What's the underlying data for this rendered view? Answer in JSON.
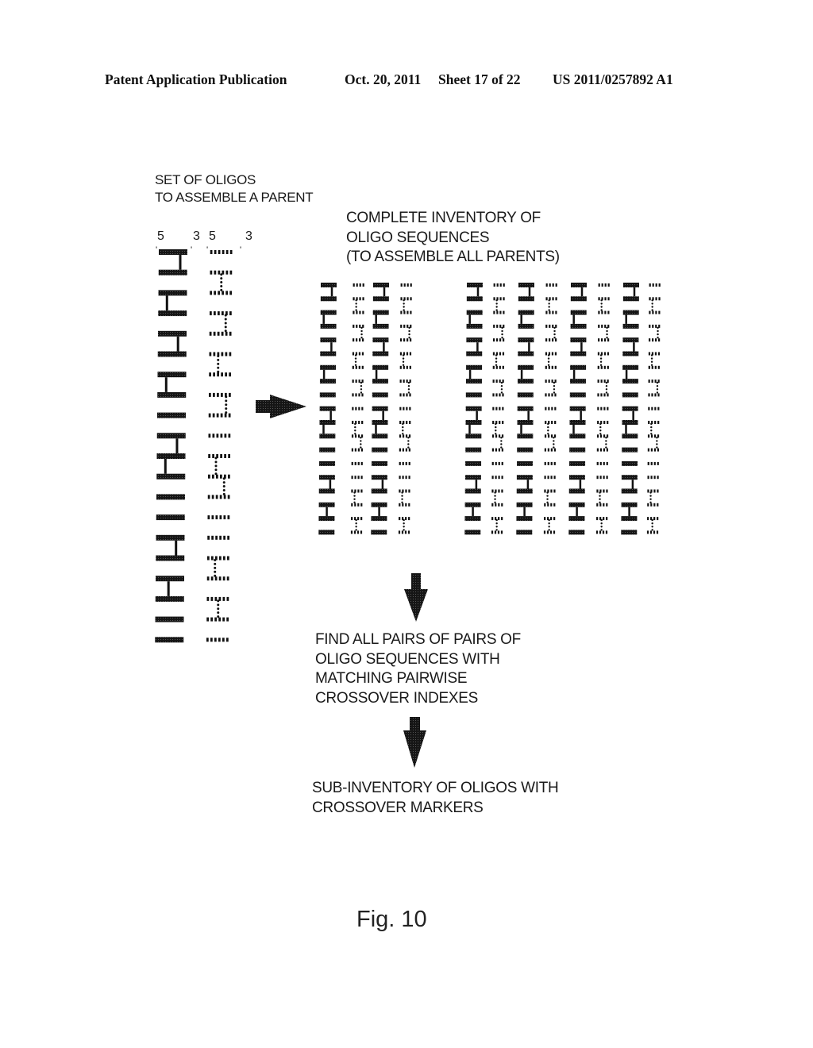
{
  "header": {
    "publication": "Patent Application Publication",
    "date": "Oct. 20, 2011",
    "sheet": "Sheet 17 of 22",
    "patent_number": "US 2011/0257892 A1"
  },
  "parent_set": {
    "title_lines": [
      "SET OF OLIGOS",
      "TO ASSEMBLE A PARENT"
    ],
    "strand_labels": {
      "solid": {
        "five_prime": "5",
        "three_prime": "3"
      },
      "dotted": {
        "five_prime": "5",
        "three_prime": "3"
      }
    },
    "oligo_count": 20,
    "solid_links": [
      {
        "from": 0,
        "to": 1,
        "pos": 0.75
      },
      {
        "from": 2,
        "to": 3,
        "pos": 0.3
      },
      {
        "from": 4,
        "to": 5,
        "pos": 0.7
      },
      {
        "from": 6,
        "to": 7,
        "pos": 0.3
      },
      {
        "from": 9,
        "to": 10,
        "pos": 0.7
      },
      {
        "from": 10,
        "to": 11,
        "pos": 0.3
      },
      {
        "from": 14,
        "to": 15,
        "pos": 0.7
      },
      {
        "from": 16,
        "to": 17,
        "pos": 0.45
      }
    ],
    "dotted_links": [
      {
        "from": 1,
        "to": 2,
        "pos": 0.5
      },
      {
        "from": 3,
        "to": 4,
        "pos": 0.7
      },
      {
        "from": 5,
        "to": 6,
        "pos": 0.4
      },
      {
        "from": 7,
        "to": 8,
        "pos": 0.75
      },
      {
        "from": 10,
        "to": 11,
        "pos": 0.35
      },
      {
        "from": 11,
        "to": 12,
        "pos": 0.7
      },
      {
        "from": 15,
        "to": 16,
        "pos": 0.35
      },
      {
        "from": 17,
        "to": 18,
        "pos": 0.5
      }
    ]
  },
  "inventory": {
    "title_lines": [
      "COMPLETE INVENTORY OF",
      "OLIGO SEQUENCES",
      "(TO ASSEMBLE ALL PARENTS)"
    ],
    "groups": [
      {
        "name": "group-1",
        "parents": 2
      },
      {
        "name": "group-2",
        "parents": 4
      }
    ],
    "oligo_rows": 20,
    "solid_links": [
      {
        "from": 0,
        "to": 1,
        "pos": 0.7
      },
      {
        "from": 2,
        "to": 3,
        "pos": 0.2
      },
      {
        "from": 4,
        "to": 5,
        "pos": 0.7
      },
      {
        "from": 6,
        "to": 7,
        "pos": 0.25
      },
      {
        "from": 9,
        "to": 10,
        "pos": 0.7
      },
      {
        "from": 10,
        "to": 11,
        "pos": 0.25
      },
      {
        "from": 14,
        "to": 15,
        "pos": 0.7
      },
      {
        "from": 16,
        "to": 17,
        "pos": 0.5
      }
    ],
    "dotted_links": [
      {
        "from": 1,
        "to": 2,
        "pos": 0.3
      },
      {
        "from": 3,
        "to": 4,
        "pos": 0.75
      },
      {
        "from": 5,
        "to": 6,
        "pos": 0.3
      },
      {
        "from": 7,
        "to": 8,
        "pos": 0.75
      },
      {
        "from": 10,
        "to": 11,
        "pos": 0.3
      },
      {
        "from": 11,
        "to": 12,
        "pos": 0.75
      },
      {
        "from": 15,
        "to": 16,
        "pos": 0.3
      },
      {
        "from": 17,
        "to": 18,
        "pos": 0.45
      }
    ]
  },
  "steps": [
    {
      "lines": [
        "FIND ALL PAIRS OF PAIRS OF",
        "OLIGO SEQUENCES WITH",
        "MATCHING PAIRWISE",
        "CROSSOVER INDEXES"
      ]
    },
    {
      "lines": [
        "SUB-INVENTORY OF OLIGOS WITH",
        "CROSSOVER MARKERS"
      ]
    }
  ],
  "arrows": [
    {
      "name": "parent-to-inventory-arrow",
      "direction": "right"
    },
    {
      "name": "inventory-to-pairs-arrow",
      "direction": "down"
    },
    {
      "name": "pairs-to-subinventory-arrow",
      "direction": "down"
    }
  ],
  "figure_caption": "Fig. 10",
  "colors": {
    "ink": "#111111",
    "paper": "#ffffff"
  }
}
